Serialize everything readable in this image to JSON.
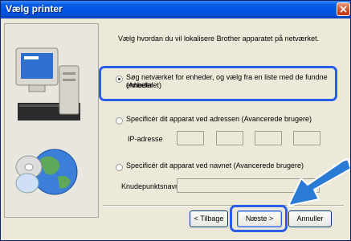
{
  "window": {
    "title": "Vælg printer"
  },
  "main": {
    "instruction": "Vælg hvordan du vil lokalisere Brother apparatet på netværket.",
    "options": [
      {
        "label": "Søg netværket for enheder, og vælg fra en liste med de fundne enheder",
        "sublabel": "(Anbefalet)",
        "selected": true
      },
      {
        "label": "Specificér dit apparat ved adressen (Avancerede brugere)",
        "selected": false
      },
      {
        "label": "Specificér dit apparat ved navnet (Avancerede brugere)",
        "selected": false
      }
    ],
    "ip_label": "IP-adresse",
    "ip_values": [
      "",
      "",
      "",
      ""
    ],
    "node_label": "Knudepunktsnavn",
    "node_value": ""
  },
  "buttons": {
    "back": "< Tilbage",
    "next": "Næste >",
    "cancel": "Annuller"
  },
  "colors": {
    "highlight": "#2a5ee8",
    "titlebar": "#0054e3"
  },
  "icons": [
    "computer-icon",
    "globe-icon",
    "close-icon",
    "pointer-arrow-icon"
  ]
}
